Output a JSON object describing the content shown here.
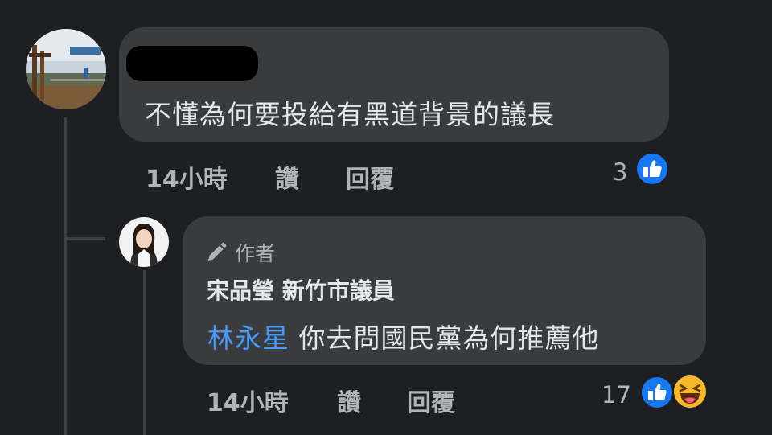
{
  "comment": {
    "text": "不懂為何要投給有黑道背景的議長",
    "time": "14小時",
    "like_label": "讚",
    "reply_label": "回覆",
    "reaction_count": "3",
    "reactions": [
      "like-icon"
    ]
  },
  "reply": {
    "badge_label": "作者",
    "badge_icon": "pencil-icon",
    "author": "宋品瑩 新竹市議員",
    "mention": "林永星",
    "text": "你去問國民黨為何推薦他",
    "time": "14小時",
    "like_label": "讚",
    "reply_label": "回覆",
    "reaction_count": "17",
    "reactions": [
      "like-icon",
      "haha-icon"
    ]
  },
  "colors": {
    "background": "#1e1f22",
    "bubble": "#3a3b3c",
    "mention": "#4599ff",
    "like": "#1877f2",
    "haha": "#f7b928"
  }
}
